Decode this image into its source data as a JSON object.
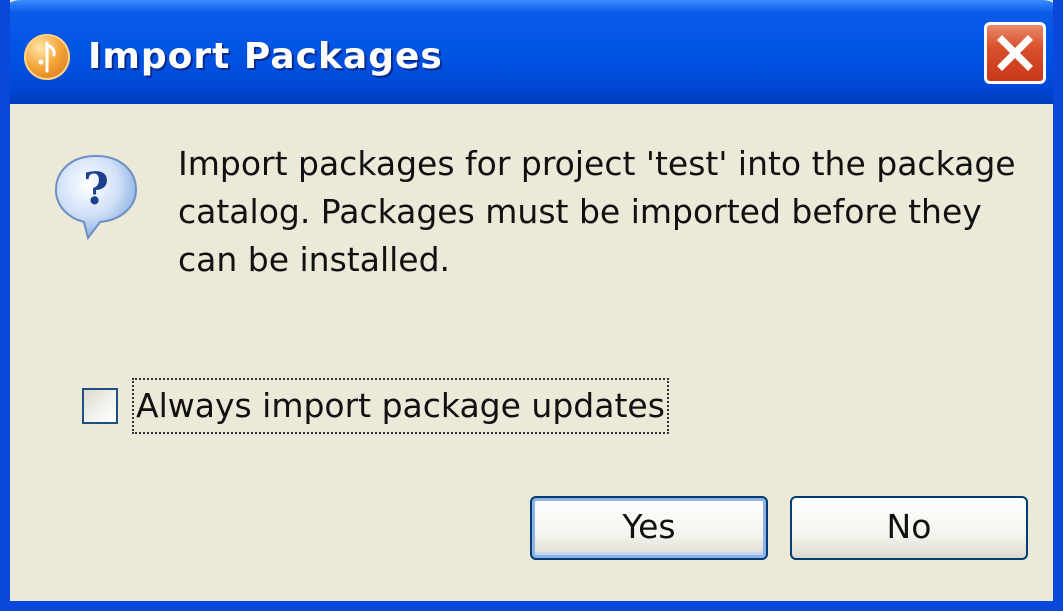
{
  "window": {
    "title": "Import Packages",
    "close_icon": "close-x-icon",
    "title_icon": "app-orb-icon"
  },
  "dialog": {
    "icon": "question-mark-icon",
    "message_lines": [
      "Import packages for project 'test' into the package",
      "catalog. Packages must be imported before they",
      "can be installed."
    ],
    "checkbox": {
      "label": "Always import package updates",
      "checked": false
    }
  },
  "buttons": {
    "yes_label": "Yes",
    "no_label": "No"
  },
  "colors": {
    "titlebar": "#0054e3",
    "frame": "#0a48dc",
    "dialog_bg": "#ece9d8",
    "close_button": "#d9502b"
  }
}
